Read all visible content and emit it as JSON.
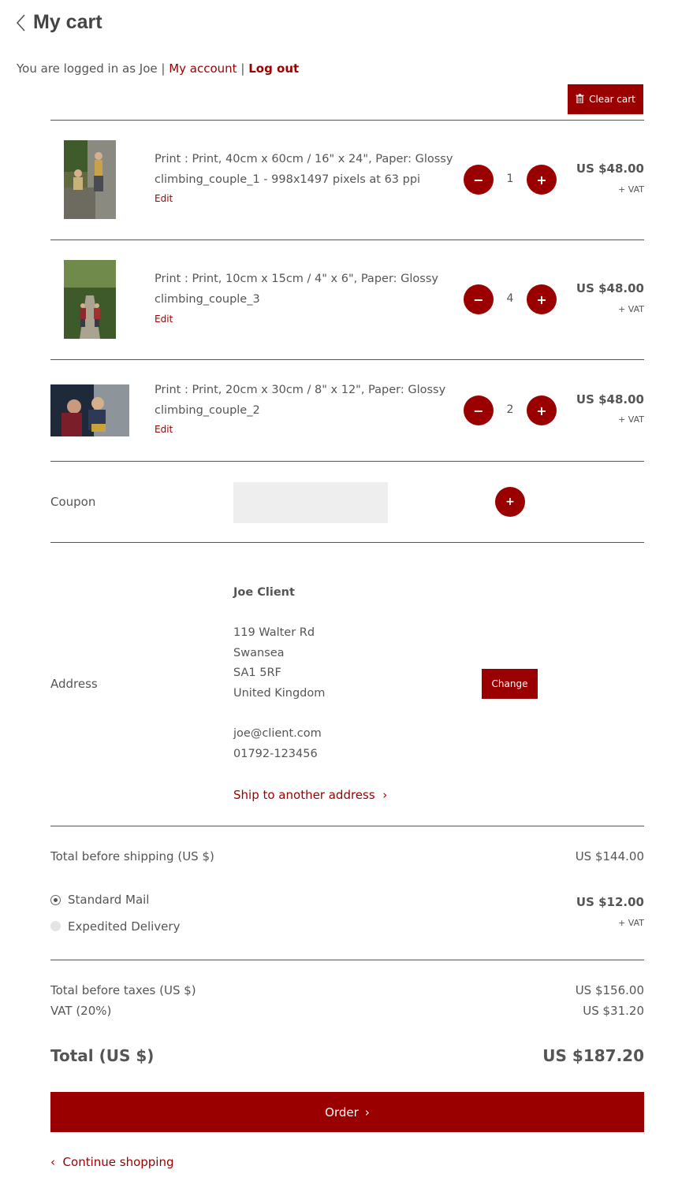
{
  "header": {
    "title": "My cart"
  },
  "session": {
    "logged_in_text": "You are logged in as Joe |",
    "my_account": "My account",
    "separator": "|",
    "logout": "Log out"
  },
  "toolbar": {
    "clear_cart": "Clear cart"
  },
  "items": [
    {
      "line1": "Print : Print, 40cm x 60cm / 16\" x 24\", Paper: Glossy",
      "line2": "climbing_couple_1 - 998x1497 pixels at 63 ppi",
      "edit": "Edit",
      "qty": "1",
      "price": "US $48.00",
      "vat": "+ VAT"
    },
    {
      "line1": "Print : Print, 10cm x 15cm / 4\" x 6\", Paper: Glossy",
      "line2": "climbing_couple_3",
      "edit": "Edit",
      "qty": "4",
      "price": "US $48.00",
      "vat": "+ VAT"
    },
    {
      "line1": "Print : Print, 20cm x 30cm / 8\" x 12\", Paper: Glossy",
      "line2": "climbing_couple_2",
      "edit": "Edit",
      "qty": "2",
      "price": "US $48.00",
      "vat": "+ VAT"
    }
  ],
  "coupon": {
    "label": "Coupon",
    "value": ""
  },
  "address": {
    "label": "Address",
    "name": "Joe Client",
    "street": "119 Walter Rd",
    "city": "Swansea",
    "postcode": "SA1 5RF",
    "country": "United Kingdom",
    "email": "joe@client.com",
    "phone": "01792-123456",
    "ship_other": "Ship to another address",
    "change": "Change"
  },
  "shipping": {
    "total_before_label": "Total before shipping (US $)",
    "total_before_value": "US $144.00",
    "options": [
      {
        "label": "Standard Mail",
        "selected": true
      },
      {
        "label": "Expedited Delivery",
        "selected": false
      }
    ],
    "price": "US $12.00",
    "vat": "+ VAT"
  },
  "totals": {
    "before_taxes_label": "Total before taxes (US $)",
    "before_taxes_value": "US $156.00",
    "vat_label": "VAT (20%)",
    "vat_value": "US $31.20",
    "total_label": "Total (US $)",
    "total_value": "US $187.20"
  },
  "actions": {
    "order": "Order",
    "continue": "Continue shopping"
  },
  "colors": {
    "accent": "#9b0000",
    "text": "#555555"
  }
}
